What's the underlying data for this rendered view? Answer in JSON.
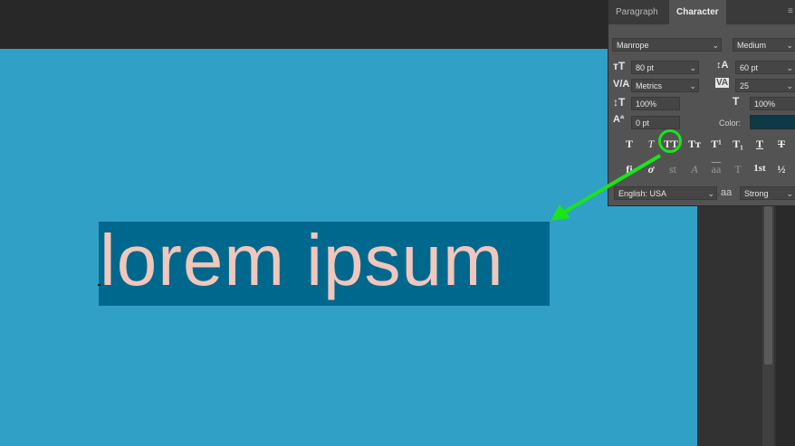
{
  "panel": {
    "tabs": [
      "Paragraph",
      "Character"
    ],
    "menu_icon": "panel-menu-icon",
    "font_family": "Manrope",
    "font_style": "Medium",
    "font_size": "80 pt",
    "leading": "60 pt",
    "kerning": "Metrics",
    "tracking": "25",
    "vertical_scale": "100%",
    "horizontal_scale": "100%",
    "baseline_shift": "0 pt",
    "color_label": "Color:",
    "language": "English: USA",
    "antialias": "Strong",
    "aa_label": "aa",
    "style_buttons": [
      "T",
      "T",
      "TT",
      "Tт",
      "T¹",
      "T₁",
      "T",
      "T"
    ],
    "opentype_buttons": [
      "fi",
      "ơ",
      "st",
      "A",
      "aa",
      "T",
      "1st",
      "½"
    ]
  },
  "canvas": {
    "selected_text": "lorem ipsum"
  },
  "colors": {
    "canvas_bg": "#31a0c6",
    "selection_bg": "#00688d",
    "text": "#f0c7bc",
    "highlight": "#19e519"
  }
}
